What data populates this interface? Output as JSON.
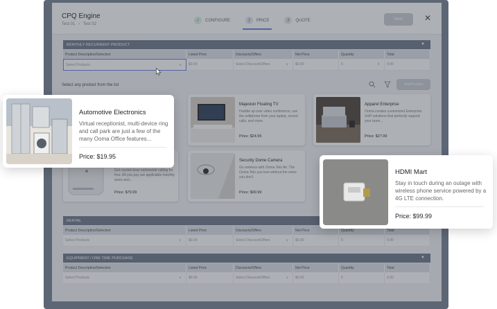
{
  "header": {
    "title": "CPQ Engine",
    "breadcrumbs": [
      "Test 01",
      "›",
      "Test 02"
    ],
    "steps": [
      {
        "label": "CONFIGURE",
        "marker": "✓"
      },
      {
        "label": "PRICE",
        "marker": "2"
      },
      {
        "label": "QUOTE",
        "marker": "3"
      }
    ],
    "next_label": "Next",
    "close_label": "✕"
  },
  "sections": {
    "monthly": {
      "title": "MONTHLY RECURRENT PRODUCT",
      "columns": [
        "Product Description/Selection",
        "Listed Price",
        "Discounts/Offers",
        "Net Price",
        "Quantity",
        "Total"
      ],
      "row": [
        "Select Products",
        "$0.00",
        "Select Discount/Offers",
        "$0.00",
        "0",
        "0.00"
      ]
    },
    "rental": {
      "title": "RENTAL",
      "columns": [
        "Product Description/Selection",
        "Listed Price",
        "Discounts/Offers",
        "Net Price",
        "Quantity",
        "Total"
      ],
      "row": [
        "Select Products",
        "$0.00",
        "Select Discount/Offers",
        "$0.00",
        "0",
        "0.00"
      ]
    },
    "equipment": {
      "title": "EQUIPMENT / ONE TIME PURCHASE",
      "columns": [
        "Product Description/Selection",
        "Listed Price",
        "Discounts/Offers",
        "Net Price",
        "Quantity",
        "Total"
      ],
      "row": [
        "Select Products",
        "$0.00",
        "Select Discount/Offers",
        "$0.00",
        "0",
        "0.00"
      ]
    }
  },
  "product_list": {
    "label": "Select any product from the list",
    "add_label": "Add Product"
  },
  "cards": [
    {
      "title": "Majeston Floating TV",
      "desc": "Huddle up over video conference, use the softphone from your laptop, record calls, and more.",
      "price": "Price: $24.95"
    },
    {
      "title": "Apparel Enterprise",
      "desc": "Ooma creates customized Enterprise VoIP solutions that perfectly support your team...",
      "price": "Price: $27.99"
    },
    {
      "title": "",
      "desc": "Get crystal-clear nationwide calling for free. All you pay are applicable monthly taxes and...",
      "price": "Price: $79.99"
    },
    {
      "title": "Security Dome Camera",
      "desc": "Go wireless with Ooma Telo Air. The Ooma Telo you love without the wires you don't.",
      "price": "Price: $99.99"
    }
  ],
  "popups": [
    {
      "title": "Automotive Electronics",
      "desc": "Virtual receptionist, multi-device ring and call park are just a few of the many Ooma Office features...",
      "price": "Price: $19.95"
    },
    {
      "title": "HDMI Mart",
      "desc": "Stay in touch during an outage with wireless phone service powered by a 4G LTE connection.",
      "price": "Price: $99.99"
    }
  ],
  "colors": {
    "section_bar": "#6a7587",
    "accent": "#6b7bd6",
    "frame": "#5d6674"
  },
  "icons": [
    "check-icon",
    "search-icon",
    "filter-icon",
    "chevron-down-icon",
    "stepper-icon",
    "close-icon",
    "cursor-icon"
  ]
}
